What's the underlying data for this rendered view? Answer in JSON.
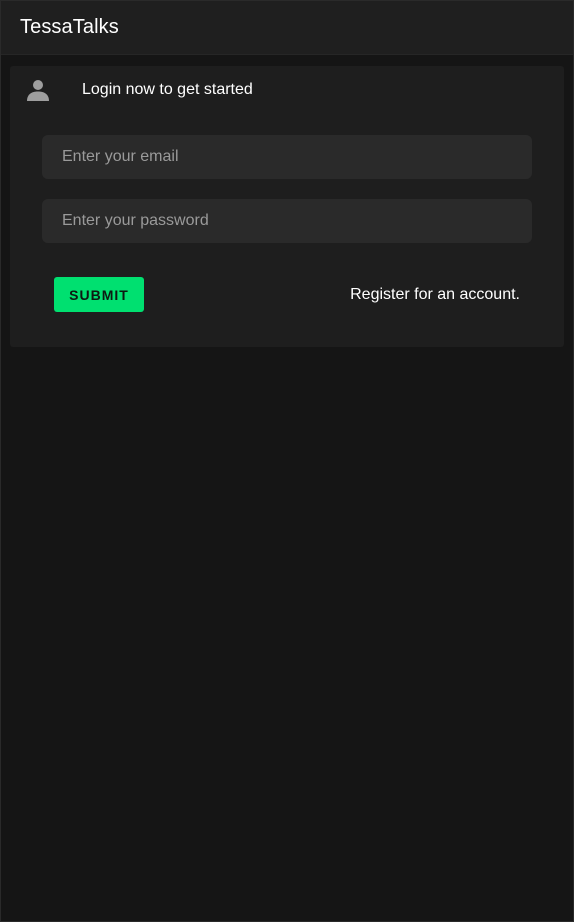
{
  "app": {
    "title": "TessaTalks"
  },
  "login_card": {
    "header_icon": "user-icon",
    "header_text": "Login now to get started",
    "email_field": {
      "value": "",
      "placeholder": "Enter your email"
    },
    "password_field": {
      "value": "",
      "placeholder": "Enter your password"
    },
    "submit_label": "SUBMIT",
    "register_link": "Register for an account."
  },
  "colors": {
    "background": "#151515",
    "app_bar": "#1f1f1f",
    "card": "#1e1e1e",
    "input": "#2a2a2a",
    "accent": "#00e070",
    "icon": "#9e9e9e"
  }
}
